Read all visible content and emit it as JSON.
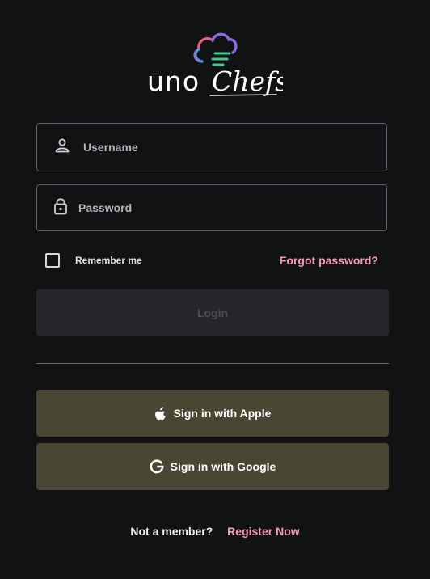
{
  "brand": {
    "logo_wordmark": "unoChefs",
    "colors": {
      "pink": "#ee5d84",
      "blue": "#4c9be8",
      "purple": "#8b6ce6",
      "green": "#3cc98a"
    }
  },
  "form": {
    "username": {
      "placeholder": "Username",
      "value": "",
      "icon": "user-icon"
    },
    "password": {
      "placeholder": "Password",
      "value": "",
      "icon": "lock-icon"
    },
    "remember_label": "Remember me",
    "remember_checked": false,
    "forgot_label": "Forgot password?",
    "login_label": "Login"
  },
  "social": {
    "apple_label": "Sign in with Apple",
    "apple_icon": "apple-icon",
    "google_label": "Sign in with Google",
    "google_icon": "google-icon"
  },
  "footer": {
    "prompt": "Not a member?",
    "register_label": "Register Now"
  },
  "theme": {
    "background": "#111214",
    "accent": "#f59ab1",
    "social_button": "#4a4634"
  }
}
